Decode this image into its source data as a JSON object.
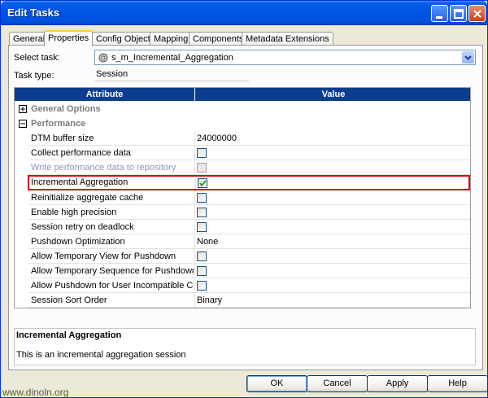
{
  "window": {
    "title": "Edit Tasks"
  },
  "tabs": [
    {
      "label": "General"
    },
    {
      "label": "Properties"
    },
    {
      "label": "Config Object"
    },
    {
      "label": "Mapping"
    },
    {
      "label": "Components"
    },
    {
      "label": "Metadata Extensions"
    }
  ],
  "form": {
    "select_task_label": "Select task:",
    "select_task_value": "s_m_Incremental_Aggregation",
    "task_type_label": "Task type:",
    "task_type_value": "Session"
  },
  "grid": {
    "col_attribute": "Attribute",
    "col_value": "Value",
    "groups": [
      {
        "label": "General Options",
        "expanded": false
      },
      {
        "label": "Performance",
        "expanded": true
      }
    ],
    "rows": [
      {
        "attr": "DTM buffer size",
        "value": "24000000",
        "type": "text"
      },
      {
        "attr": "Collect performance data",
        "checked": false,
        "type": "checkbox"
      },
      {
        "attr": "Write performance data to repository",
        "checked": false,
        "type": "checkbox",
        "disabled": true
      },
      {
        "attr": "Incremental Aggregation",
        "checked": true,
        "type": "checkbox",
        "highlighted": true
      },
      {
        "attr": "Reinitialize aggregate cache",
        "checked": false,
        "type": "checkbox"
      },
      {
        "attr": "Enable high precision",
        "checked": false,
        "type": "checkbox"
      },
      {
        "attr": "Session retry on deadlock",
        "checked": false,
        "type": "checkbox"
      },
      {
        "attr": "Pushdown Optimization",
        "value": "None",
        "type": "text"
      },
      {
        "attr": "Allow Temporary View for Pushdown",
        "checked": false,
        "type": "checkbox"
      },
      {
        "attr": "Allow Temporary Sequence for Pushdown",
        "checked": false,
        "type": "checkbox"
      },
      {
        "attr": "Allow Pushdown for User Incompatible Conn...",
        "checked": false,
        "type": "checkbox"
      },
      {
        "attr": "Session Sort Order",
        "value": "Binary",
        "type": "text"
      }
    ]
  },
  "description": {
    "title": "Incremental Aggregation",
    "text": "This is an incremental aggregation session"
  },
  "buttons": {
    "ok": "OK",
    "cancel": "Cancel",
    "apply": "Apply",
    "help": "Help"
  },
  "watermark": "www.dinoln.org",
  "colors": {
    "highlight_border": "#d40000",
    "grid_header": "#0b3d91",
    "titlebar": "#0055e5"
  }
}
